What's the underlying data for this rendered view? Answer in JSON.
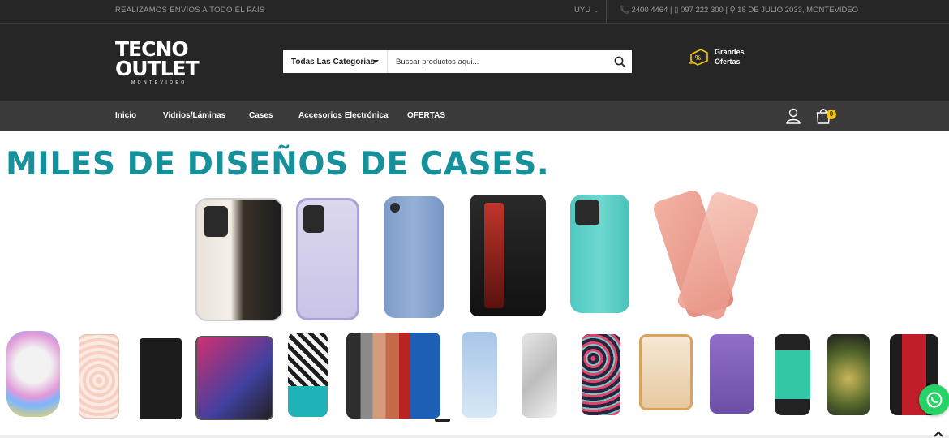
{
  "topbar": {
    "shipping_text": "REALIZAMOS ENVÍOS A TODO EL PAÍS",
    "currency": "UYU",
    "contact": "📞 2400 4464 | ▯ 097 222 300 | ⚲ 18 DE JULIO 2033, MONTEVIDEO"
  },
  "header": {
    "logo": {
      "line1": "TECNO",
      "line2": "OUTLET",
      "line3": "MONTEVIDEO"
    },
    "search": {
      "category": "Todas Las Categorias",
      "placeholder": "Buscar productos aqui..."
    },
    "offers": {
      "line1": "Grandes",
      "line2": "Ofertas"
    }
  },
  "nav": {
    "items": [
      {
        "label": "Inicio"
      },
      {
        "label": "Vidrios/Láminas"
      },
      {
        "label": "Cases"
      },
      {
        "label": "Accesorios Electrónica"
      },
      {
        "label": "OFERTAS"
      }
    ],
    "cart_count": "0"
  },
  "banner": {
    "headline": "MILES DE DISEÑOS DE CASES."
  },
  "colors": {
    "topbar_bg": "#262626",
    "nav_bg": "#3a3a3a",
    "headline": "#16909b",
    "badge": "#f7c600",
    "whatsapp": "#25d366"
  }
}
